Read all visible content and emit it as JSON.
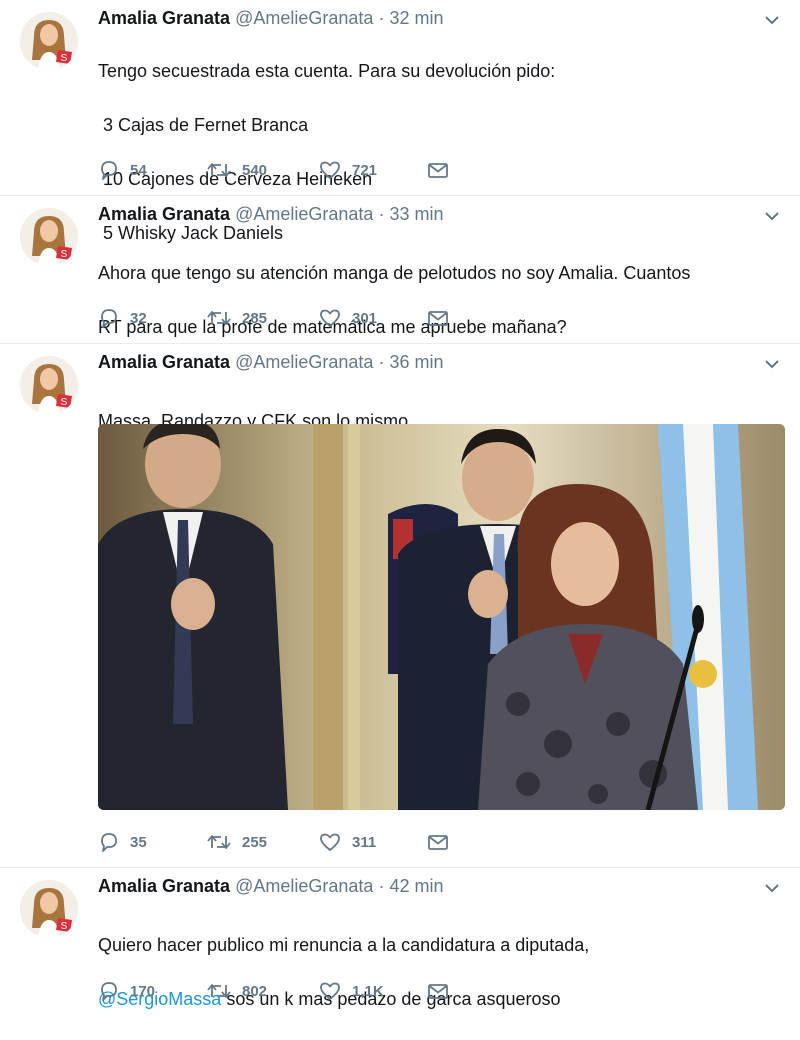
{
  "tweets": [
    {
      "name": "Amalia Granata",
      "handle": "@AmelieGranata",
      "separator": "·",
      "time": "32 min",
      "lines": [
        "Tengo secuestrada esta cuenta. Para su devolución pido:",
        " 3 Cajas de Fernet Branca",
        " 10 Cajones de Cerveza Heineken",
        " 5 Whisky Jack Daniels"
      ],
      "replies": "54",
      "retweets": "540",
      "likes": "721"
    },
    {
      "name": "Amalia Granata",
      "handle": "@AmelieGranata",
      "separator": "·",
      "time": "33 min",
      "lines": [
        "Ahora que tengo su atención manga de pelotudos no soy Amalia. Cuantos",
        "RT para que la profe de matemática me apruebe mañana?"
      ],
      "replies": "32",
      "retweets": "285",
      "likes": "301"
    },
    {
      "name": "Amalia Granata",
      "handle": "@AmelieGranata",
      "separator": "·",
      "time": "36 min",
      "lines": [
        "Massa, Randazzo y CFK son lo mismo"
      ],
      "replies": "35",
      "retweets": "255",
      "likes": "311"
    },
    {
      "name": "Amalia Granata",
      "handle": "@AmelieGranata",
      "separator": "·",
      "time": "42 min",
      "line1": "Quiero hacer publico mi renuncia a la candidatura a diputada,",
      "mention": "@SergioMassa",
      "line2_rest": " sos un k mas pedazo de garca asqueroso",
      "replies": "170",
      "retweets": "802",
      "likes": "1,1K"
    }
  ],
  "icons": {
    "reply": "reply-icon",
    "retweet": "retweet-icon",
    "like": "heart-icon",
    "message": "envelope-icon",
    "caret": "chevron-down-icon"
  },
  "colors": {
    "text": "#14171a",
    "secondary": "#657786",
    "link": "#1b95e0",
    "divider": "#e6ecf0"
  }
}
